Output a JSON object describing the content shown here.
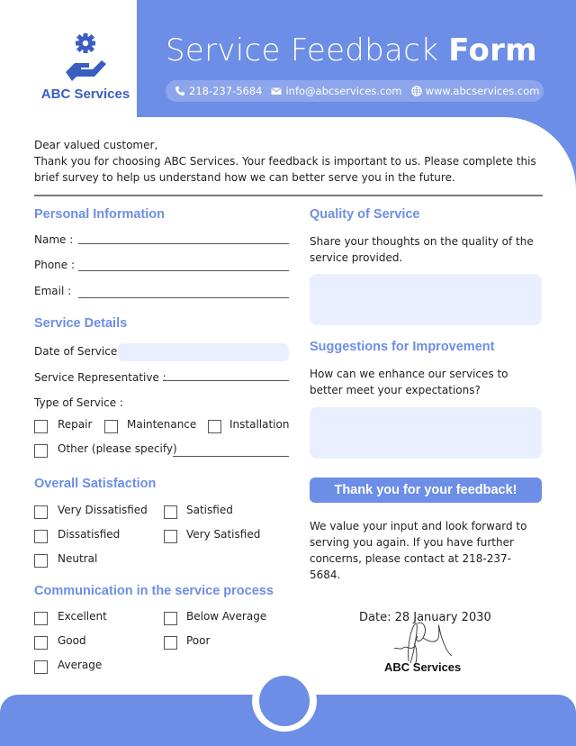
{
  "header": {
    "brand_name": "ABC Services",
    "title_light": "Service Feedback",
    "title_bold": "Form",
    "contact": {
      "phone": "218-237-5684",
      "email": "info@abcservices.com",
      "website": "www.abcservices.com"
    }
  },
  "intro": {
    "greeting": "Dear valued customer,",
    "body": "Thank you for choosing ABC Services. Your feedback is important to us. Please complete this brief survey to help us understand how we can better serve you in the future."
  },
  "personal_information": {
    "heading": "Personal Information",
    "fields": [
      {
        "label": "Name :",
        "value": ""
      },
      {
        "label": "Phone :",
        "value": ""
      },
      {
        "label": "Email :",
        "value": ""
      }
    ]
  },
  "service_details": {
    "heading": "Service Details",
    "date_label": "Date of Service",
    "date_value": "",
    "rep_label": "Service Representative :",
    "rep_value": "",
    "type_label": "Type of Service :",
    "types": [
      {
        "label": "Repair",
        "checked": false
      },
      {
        "label": "Maintenance",
        "checked": false
      },
      {
        "label": "Installation",
        "checked": false
      },
      {
        "label": "Other (please specify)",
        "checked": false
      }
    ],
    "other_value": ""
  },
  "overall_satisfaction": {
    "heading": "Overall Satisfaction",
    "options": [
      {
        "label": "Very Dissatisfied",
        "checked": false
      },
      {
        "label": "Dissatisfied",
        "checked": false
      },
      {
        "label": "Neutral",
        "checked": false
      },
      {
        "label": "Satisfied",
        "checked": false
      },
      {
        "label": "Very Satisfied",
        "checked": false
      }
    ]
  },
  "communication": {
    "heading": "Communication in the service process",
    "options": [
      {
        "label": "Excellent",
        "checked": false
      },
      {
        "label": "Good",
        "checked": false
      },
      {
        "label": "Average",
        "checked": false
      },
      {
        "label": "Below Average",
        "checked": false
      },
      {
        "label": "Poor",
        "checked": false
      }
    ]
  },
  "quality_of_service": {
    "heading": "Quality of Service",
    "prompt": "Share your thoughts on the quality of the service provided.",
    "value": ""
  },
  "suggestions": {
    "heading": "Suggestions for Improvement",
    "prompt": "How can we enhance our services to better meet your expectations?",
    "value": ""
  },
  "closing": {
    "thanks_label": "Thank you for your feedback!",
    "message": "We value your input and look forward to serving you again. If you have further concerns, please contact at 218-237-5684.",
    "date": "Date: 28 January 2030",
    "signature_name": "ABC Services"
  },
  "colors": {
    "accent": "#6d8ee6",
    "brand_dark": "#3b5dc0",
    "field_fill": "#e9efff"
  }
}
